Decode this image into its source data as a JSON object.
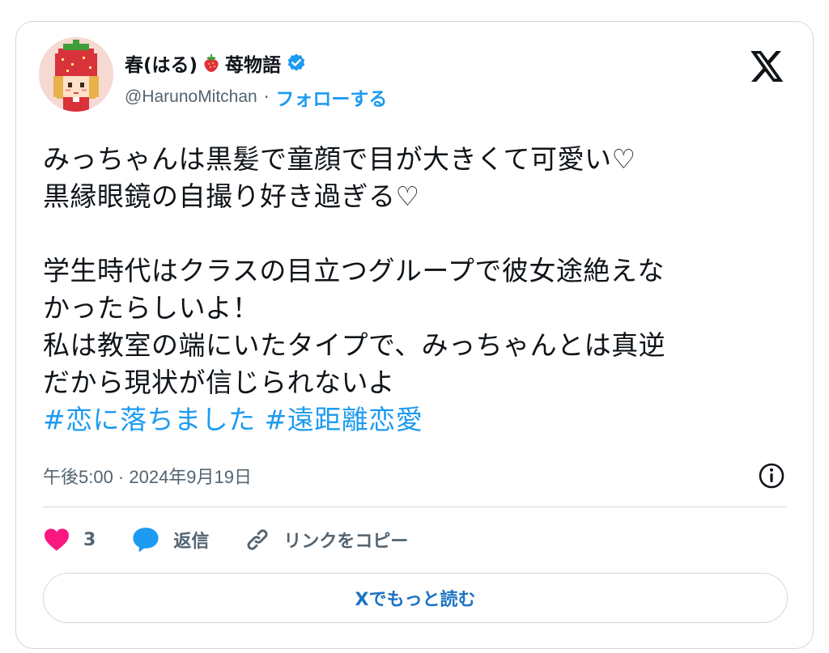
{
  "author": {
    "display_name": "春(はる)",
    "display_suffix": "苺物語",
    "handle": "@HarunoMitchan",
    "separator": "·",
    "follow_label": "フォローする"
  },
  "tweet": {
    "lines": [
      "みっちゃんは黒髪で童顔で目が大きくて可愛い♡",
      "黒縁眼鏡の自撮り好き過ぎる♡",
      "",
      "学生時代はクラスの目立つグループで彼女途絶えな",
      "かったらしいよ！",
      "私は教室の端にいたタイプで、みっちゃんとは真逆",
      "だから現状が信じられないよ"
    ],
    "hashtags": [
      "#恋に落ちました",
      "#遠距離恋愛"
    ],
    "timestamp": "午後5:00 · 2024年9月19日"
  },
  "actions": {
    "like_count": "3",
    "reply_label": "返信",
    "copy_link_label": "リンクをコピー"
  },
  "read_more_label": "Xでもっと読む",
  "colors": {
    "accent": "#1d9bf0",
    "like": "#f91880",
    "muted_text": "#536471",
    "border": "#cfd9de"
  },
  "icons": {
    "emoji": "strawberry-icon",
    "verified": "verified-badge-icon",
    "brand": "x-logo-icon",
    "info": "info-icon",
    "like": "heart-icon",
    "reply": "speech-bubble-icon",
    "copy": "link-icon"
  }
}
